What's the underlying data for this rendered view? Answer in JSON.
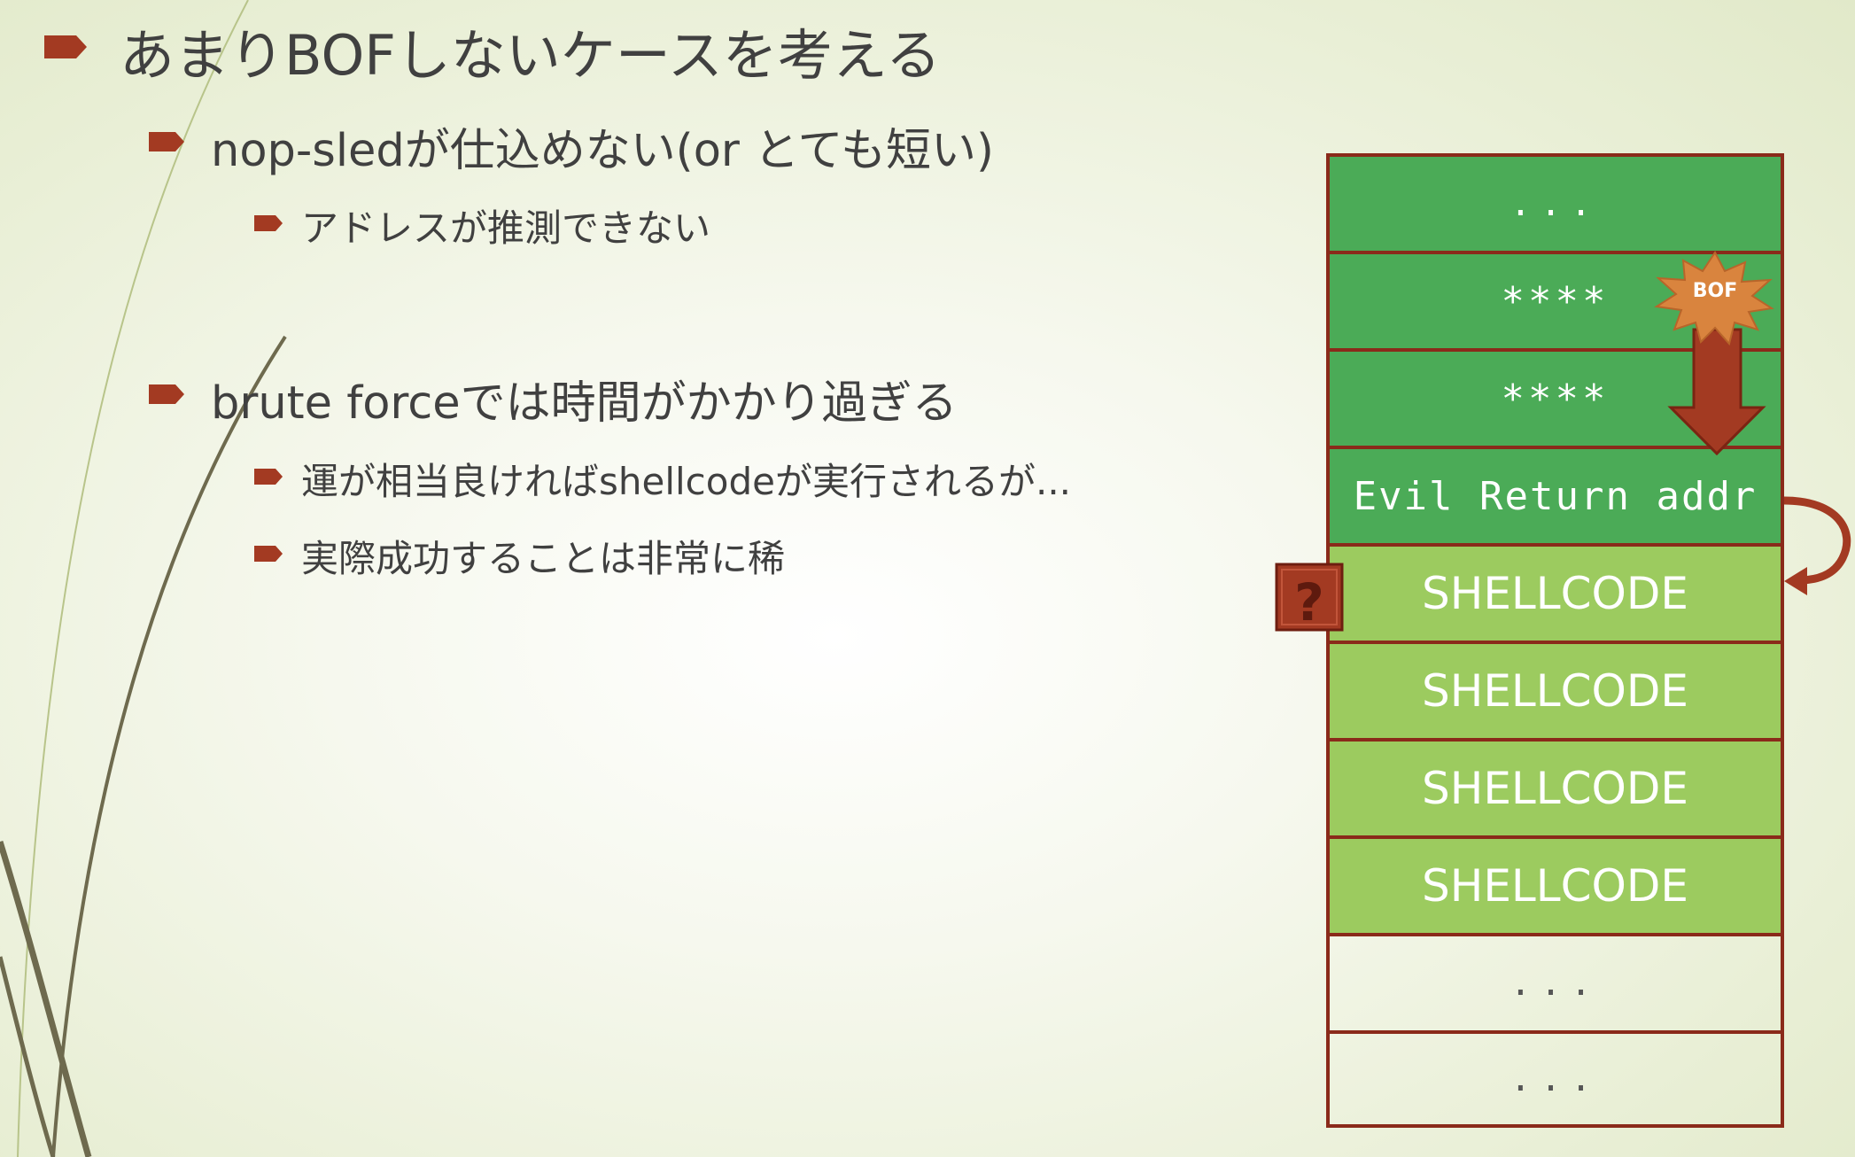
{
  "slide": {
    "heading": "あまりBOFしないケースを考える",
    "points": [
      {
        "text": "nop-sledが仕込めない(or とても短い)",
        "sub": [
          "アドレスが推測できない"
        ]
      },
      {
        "text": "brute forceでは時間がかかり過ぎる",
        "sub": [
          "運が相当良ければshellcodeが実行されるが...",
          "実際成功することは非常に稀"
        ]
      }
    ]
  },
  "stack_diagram": {
    "cells": [
      {
        "label": "...",
        "style": "dark"
      },
      {
        "label": "****",
        "style": "dark"
      },
      {
        "label": "****",
        "style": "dark"
      },
      {
        "label": "Evil Return addr",
        "style": "dark"
      },
      {
        "label": "SHELLCODE",
        "style": "light"
      },
      {
        "label": "SHELLCODE",
        "style": "light"
      },
      {
        "label": "SHELLCODE",
        "style": "light"
      },
      {
        "label": "SHELLCODE",
        "style": "light"
      },
      {
        "label": "...",
        "style": "empty"
      },
      {
        "label": "...",
        "style": "empty"
      }
    ],
    "burst_label": "BOF",
    "question_mark": "?"
  },
  "colors": {
    "bullet": "#a33a22",
    "text": "#404040",
    "stack_dark": "#4bab57",
    "stack_light": "#9ccb5f",
    "stack_border": "#8a2a1a",
    "burst": "#d9843e",
    "arrow": "#a33a22"
  },
  "icons": [
    "bullet-arrow-icon",
    "bof-burst-icon",
    "down-arrow-icon",
    "curved-arrow-icon",
    "question-block-icon"
  ]
}
